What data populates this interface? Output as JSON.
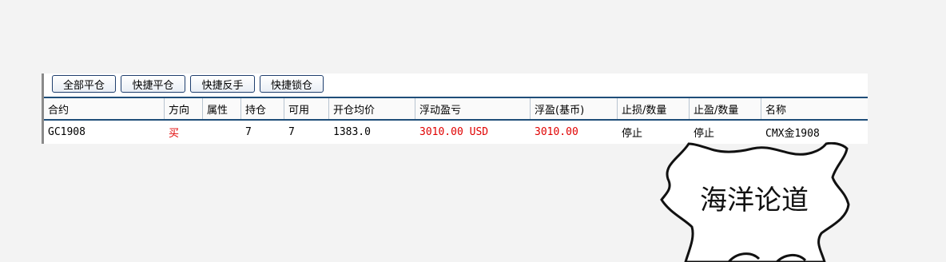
{
  "toolbar": {
    "close_all": "全部平仓",
    "quick_close": "快捷平仓",
    "quick_reverse": "快捷反手",
    "quick_lock": "快捷锁仓"
  },
  "table": {
    "headers": [
      "合约",
      "方向",
      "属性",
      "持仓",
      "可用",
      "开仓均价",
      "浮动盈亏",
      "浮盈(基币)",
      "止损/数量",
      "止盈/数量",
      "名称"
    ],
    "rows": [
      [
        "GC1908",
        "买",
        "",
        "7",
        "7",
        "1383.0",
        "3010.00 USD",
        "3010.00",
        "停止",
        "停止",
        "CMX金1908"
      ]
    ]
  },
  "watermark": "海洋论道",
  "colors": {
    "profit": "#e00000",
    "border": "#1f4e79"
  }
}
